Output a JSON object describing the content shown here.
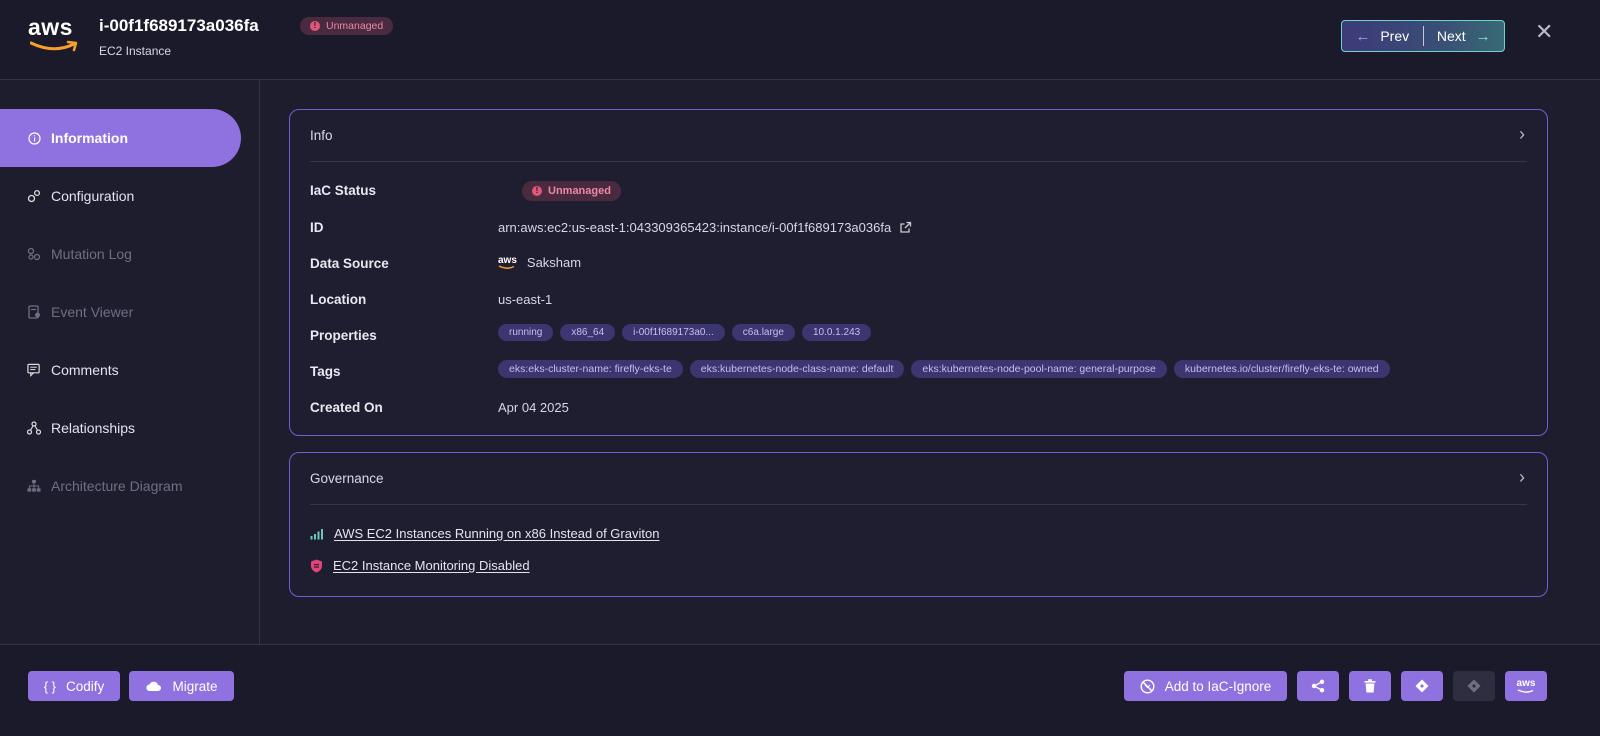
{
  "header": {
    "logo_text": "aws",
    "title": "i-00f1f689173a036fa",
    "subtitle": "EC2 Instance",
    "status_badge": "Unmanaged",
    "prev_label": "Prev",
    "next_label": "Next"
  },
  "sidebar": {
    "items": [
      {
        "label": "Information",
        "icon": "info-icon",
        "active": true
      },
      {
        "label": "Configuration",
        "icon": "gears-icon"
      },
      {
        "label": "Mutation Log",
        "icon": "mutation-icon",
        "disabled": true
      },
      {
        "label": "Event Viewer",
        "icon": "event-icon",
        "disabled": true
      },
      {
        "label": "Comments",
        "icon": "comments-icon"
      },
      {
        "label": "Relationships",
        "icon": "relationships-icon"
      },
      {
        "label": "Architecture Diagram",
        "icon": "diagram-icon",
        "disabled": true
      }
    ]
  },
  "info": {
    "heading": "Info",
    "iac_status_label": "IaC Status",
    "iac_status_value": "Unmanaged",
    "id_label": "ID",
    "id_value": "arn:aws:ec2:us-east-1:043309365423:instance/i-00f1f689173a036fa",
    "data_source_label": "Data Source",
    "data_source_value": "Saksham",
    "location_label": "Location",
    "location_value": "us-east-1",
    "properties_label": "Properties",
    "properties": [
      "running",
      "x86_64",
      "i-00f1f689173a0...",
      "c6a.large",
      "10.0.1.243"
    ],
    "tags_label": "Tags",
    "tags": [
      "eks:eks-cluster-name: firefly-eks-te",
      "eks:kubernetes-node-class-name: default",
      "eks:kubernetes-node-pool-name: general-purpose",
      "kubernetes.io/cluster/firefly-eks-te: owned"
    ],
    "created_label": "Created On",
    "created_value": "Apr 04 2025"
  },
  "governance": {
    "heading": "Governance",
    "items": [
      {
        "label": "AWS EC2 Instances Running on x86 Instead of Graviton",
        "icon": "cost-bars-icon"
      },
      {
        "label": "EC2 Instance Monitoring Disabled",
        "icon": "security-shield-icon"
      }
    ]
  },
  "footer": {
    "codify_label": "Codify",
    "migrate_label": "Migrate",
    "ignore_label": "Add to IaC-Ignore",
    "aws_console_label": "aws"
  },
  "colors": {
    "accent": "#8f72e0",
    "card_border": "#6b5fd6",
    "unmanaged_text": "#e98aa6",
    "pill_bg": "#3b3570"
  }
}
